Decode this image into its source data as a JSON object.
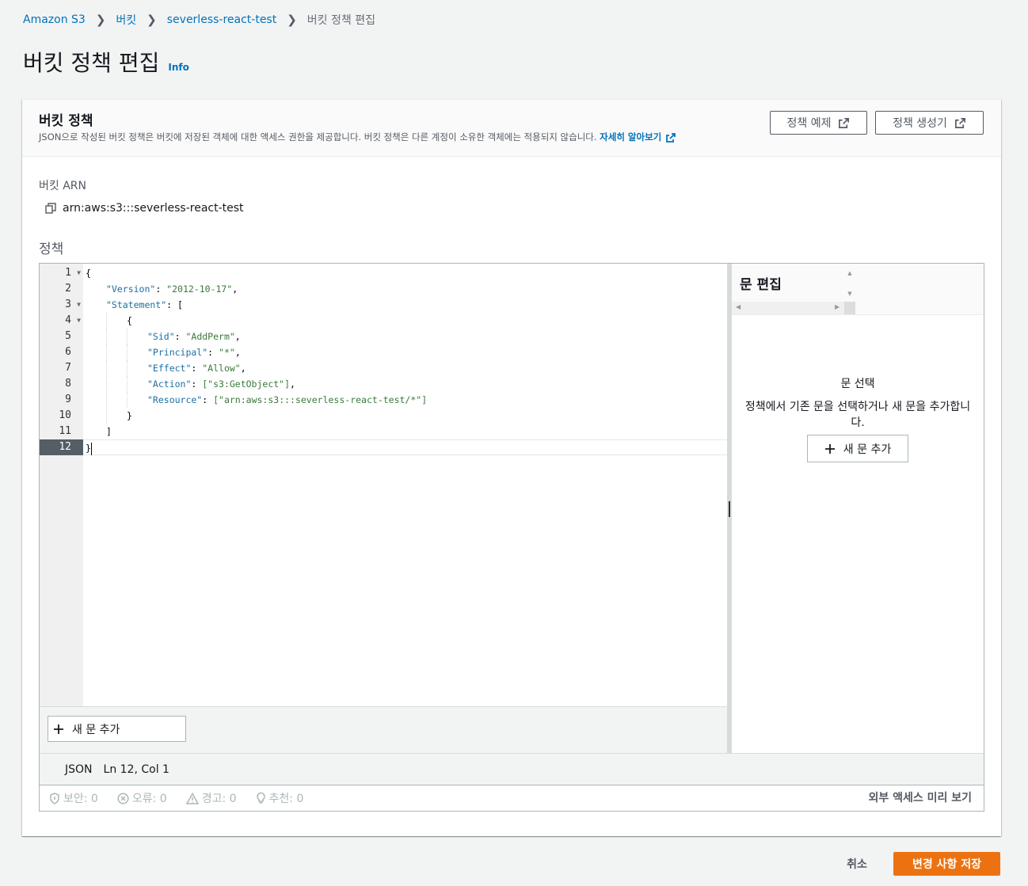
{
  "breadcrumb": {
    "root": "Amazon S3",
    "buckets": "버킷",
    "bucket": "severless-react-test",
    "current": "버킷 정책 편집"
  },
  "page": {
    "title": "버킷 정책 편집",
    "info": "Info"
  },
  "card": {
    "title": "버킷 정책",
    "description": "JSON으로 작성된 버킷 정책은 버킷에 저장된 객체에 대한 액세스 권한을 제공합니다. 버킷 정책은 다른 계정이 소유한 객체에는 적용되지 않습니다.",
    "learn_more": "자세히 알아보기",
    "policy_examples_label": "정책 예제",
    "policy_generator_label": "정책 생성기"
  },
  "arn": {
    "label": "버킷 ARN",
    "value": "arn:aws:s3:::severless-react-test"
  },
  "policy": {
    "label": "정책"
  },
  "editor": {
    "line_numbers": [
      "1",
      "2",
      "3",
      "4",
      "5",
      "6",
      "7",
      "8",
      "9",
      "10",
      "11",
      "12"
    ],
    "active_line": "12",
    "code": {
      "l1": "{",
      "l2_key": "\"Version\"",
      "l2_val": "\"2012-10-17\"",
      "l3_key": "\"Statement\"",
      "l3_rest": "[",
      "l4": "{",
      "l5_key": "\"Sid\"",
      "l5_val": "\"AddPerm\"",
      "l6_key": "\"Principal\"",
      "l6_val": "\"*\"",
      "l7_key": "\"Effect\"",
      "l7_val": "\"Allow\"",
      "l8_key": "\"Action\"",
      "l8_val": "[\"s3:GetObject\"]",
      "l9_key": "\"Resource\"",
      "l9_val": "[\"arn:aws:s3:::severless-react-test/*\"]",
      "l10": "}",
      "l11": "]",
      "l12": "}"
    },
    "add_statement_label": "새 문 추가"
  },
  "side_panel": {
    "title": "문 편집",
    "empty_title": "문 선택",
    "empty_desc": "정책에서 기존 문을 선택하거나 새 문을 추가합니다.",
    "add_statement_label": "새 문 추가"
  },
  "status_bar": {
    "mode": "JSON",
    "position": "Ln 12, Col 1"
  },
  "checks": {
    "security": "보안: 0",
    "errors": "오류: 0",
    "warnings": "경고: 0",
    "suggestions": "추천: 0",
    "preview_external_access": "외부 액세스 미리 보기"
  },
  "footer": {
    "cancel_label": "취소",
    "save_label": "변경 사항 저장"
  },
  "colors": {
    "primary_button": "#ec7211",
    "link": "#0073bb",
    "gutter_active": "#555d66"
  }
}
